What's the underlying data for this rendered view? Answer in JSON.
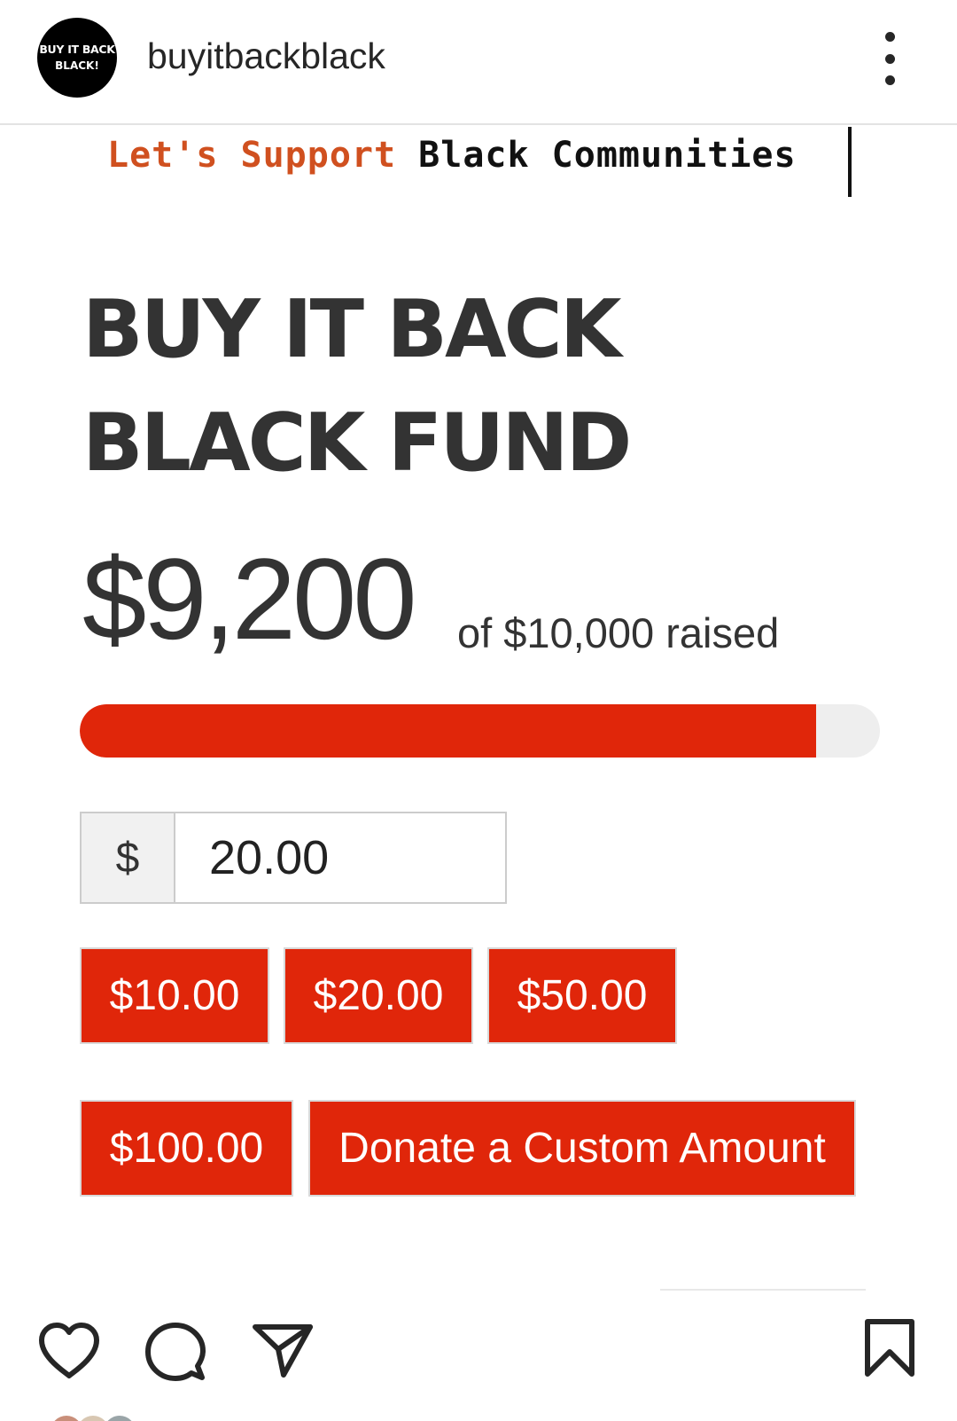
{
  "header": {
    "avatar_line1": "BUY IT BACK",
    "avatar_line2": "BLACK!",
    "username": "buyitbackblack",
    "more_icon": "more-vertical-icon"
  },
  "post": {
    "tagline_orange": "Let's Support",
    "tagline_black": "Black Communities",
    "title_line1": "BUY IT BACK",
    "title_line2": "BLACK FUND",
    "raised": "$9,200",
    "goal_text": "of $10,000 raised",
    "progress_fraction": 0.92,
    "accent_color": "#e0260a",
    "donation": {
      "currency_symbol": "$",
      "amount": "20.00"
    },
    "preset_buttons": [
      "$10.00",
      "$20.00",
      "$50.00",
      "$100.00"
    ],
    "custom_button": "Donate a Custom Amount"
  },
  "actions": {
    "icons": [
      "heart-icon",
      "comment-icon",
      "share-icon",
      "bookmark-icon"
    ]
  }
}
